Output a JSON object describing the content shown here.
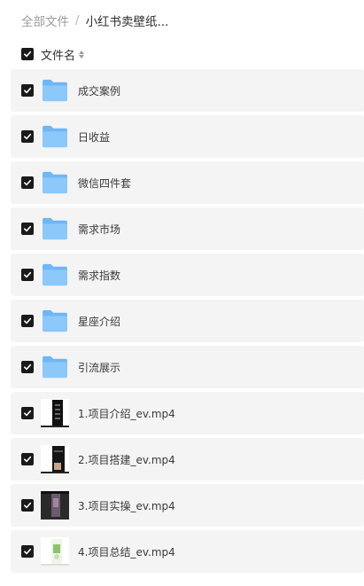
{
  "breadcrumb": {
    "root": "全部文件",
    "separator": "/",
    "current": "小红书卖壁纸..."
  },
  "list_header": {
    "label": "文件名"
  },
  "files": [
    {
      "name": "成交案例",
      "type": "folder"
    },
    {
      "name": "日收益",
      "type": "folder"
    },
    {
      "name": "微信四件套",
      "type": "folder"
    },
    {
      "name": "需求市场",
      "type": "folder"
    },
    {
      "name": "需求指数",
      "type": "folder"
    },
    {
      "name": "星座介绍",
      "type": "folder"
    },
    {
      "name": "引流展示",
      "type": "folder"
    },
    {
      "name": "1.项目介绍_ev.mp4",
      "type": "video"
    },
    {
      "name": "2.项目搭建_ev.mp4",
      "type": "video"
    },
    {
      "name": "3.项目实操_ev.mp4",
      "type": "video"
    },
    {
      "name": "4.项目总结_ev.mp4",
      "type": "video"
    }
  ],
  "colors": {
    "row_background": "#f4f4f4",
    "folder": "#6fb6f5",
    "checkbox": "#1a1a1a"
  }
}
